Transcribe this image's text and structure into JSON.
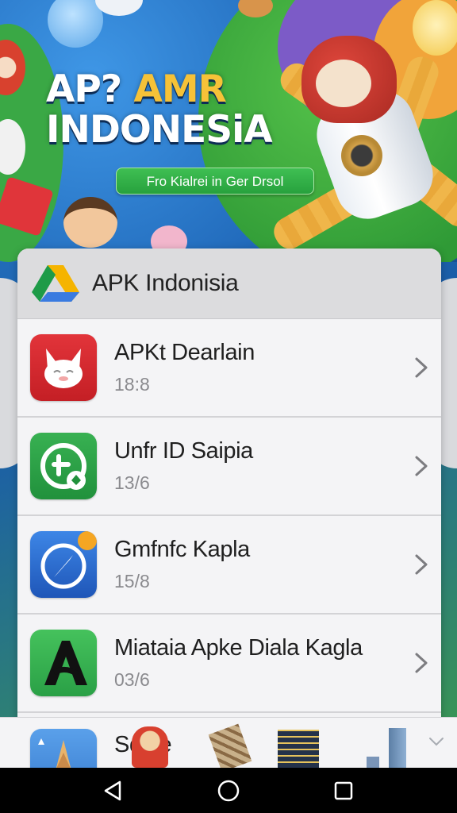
{
  "banner": {
    "title_line1_white": "AP? ",
    "title_line1_accent": "AMR",
    "title_line2": "INDONESiA",
    "pill_text": "Fro Kialrei in Ger Drsol"
  },
  "card": {
    "header_icon": "google-drive-icon",
    "header_title": "APK Indonisia"
  },
  "apps": [
    {
      "name": "APKt Dearlain",
      "meta": "18:8",
      "icon": "fox-face-icon",
      "icon_color": "#d8262b"
    },
    {
      "name": "Unfr ID Saipia",
      "meta": "13/6",
      "icon": "clock-leaf-icon",
      "icon_color": "#2a9e45"
    },
    {
      "name": "Gmfnfc Kapla",
      "meta": "15/8",
      "icon": "compass-icon",
      "icon_color": "#2c6fd1"
    },
    {
      "name": "Miataia Apke Diala Kagla",
      "meta": "03/6",
      "icon": "letter-a-icon",
      "icon_color": "#34b24f"
    }
  ],
  "bottom_row": {
    "name": "Sdlhe",
    "icon": "rocket-launch-icon"
  },
  "nav": {
    "back": "back-triangle-icon",
    "home": "home-circle-icon",
    "recents": "recents-square-icon"
  },
  "colors": {
    "accent_yellow": "#f6c238",
    "pill_green": "#2fa845",
    "navbar": "#000000"
  }
}
